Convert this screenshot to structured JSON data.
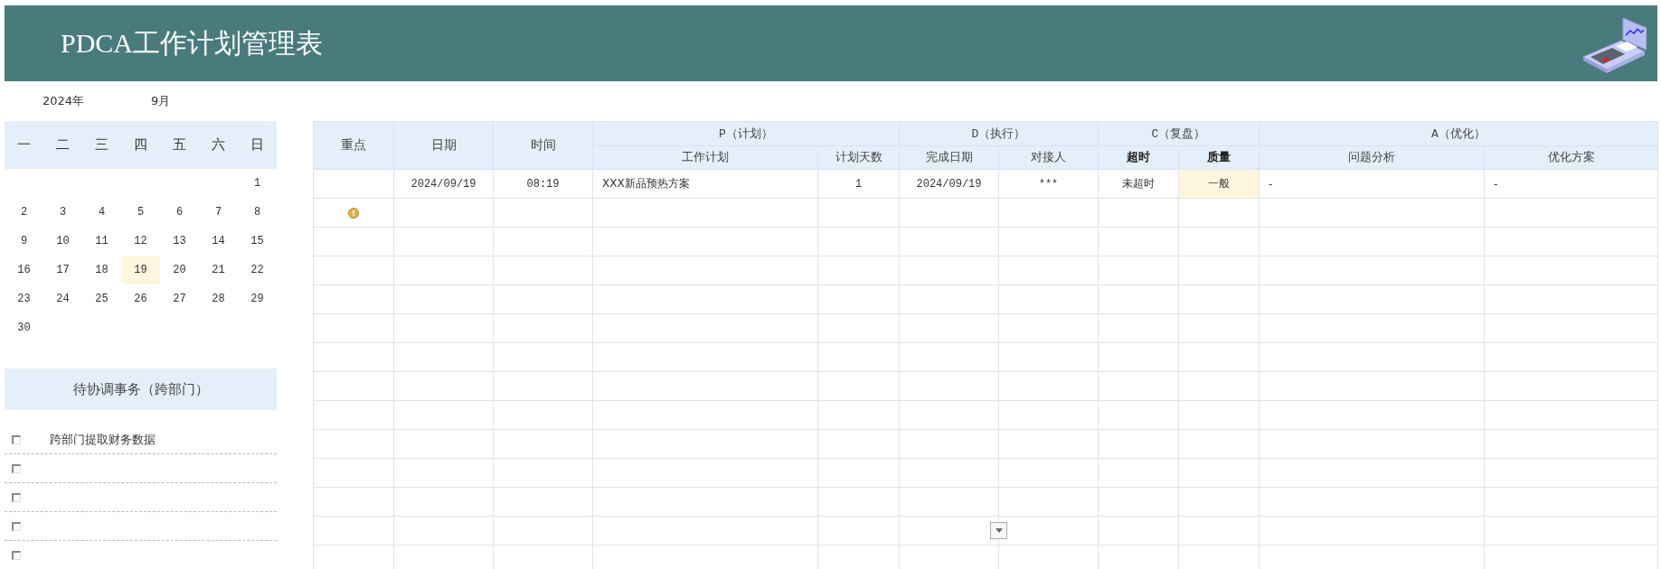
{
  "header": {
    "title": "PDCA工作计划管理表"
  },
  "calendar": {
    "year": "2024年",
    "month": "9月",
    "weekdays": [
      "一",
      "二",
      "三",
      "四",
      "五",
      "六",
      "日"
    ],
    "weeks": [
      [
        {
          "day": "1",
          "selected": false
        }
      ],
      [
        {
          "day": "2",
          "selected": false
        },
        {
          "day": "3",
          "selected": false
        },
        {
          "day": "4",
          "selected": false
        },
        {
          "day": "5",
          "selected": false
        },
        {
          "day": "6",
          "selected": false
        },
        {
          "day": "7",
          "selected": false
        },
        {
          "day": "8",
          "selected": false
        }
      ],
      [
        {
          "day": "9",
          "selected": false
        },
        {
          "day": "10",
          "selected": false
        },
        {
          "day": "11",
          "selected": false
        },
        {
          "day": "12",
          "selected": false
        },
        {
          "day": "13",
          "selected": false
        },
        {
          "day": "14",
          "selected": false
        },
        {
          "day": "15",
          "selected": false
        }
      ],
      [
        {
          "day": "16",
          "selected": false
        },
        {
          "day": "17",
          "selected": false
        },
        {
          "day": "18",
          "selected": false
        },
        {
          "day": "19",
          "selected": true
        },
        {
          "day": "20",
          "selected": false
        },
        {
          "day": "21",
          "selected": false
        },
        {
          "day": "22",
          "selected": false
        }
      ],
      [
        {
          "day": "23",
          "selected": false
        },
        {
          "day": "24",
          "selected": false
        },
        {
          "day": "25",
          "selected": false
        },
        {
          "day": "26",
          "selected": false
        },
        {
          "day": "27",
          "selected": false
        },
        {
          "day": "28",
          "selected": false
        },
        {
          "day": "29",
          "selected": false
        }
      ],
      [
        {
          "day": "30",
          "selected": false
        }
      ]
    ]
  },
  "todo": {
    "title": "待协调事务（跨部门）",
    "items": [
      {
        "text": "跨部门提取财务数据",
        "checked": false
      },
      {
        "checked": false
      },
      {
        "checked": false
      },
      {
        "checked": false
      },
      {
        "checked": false
      }
    ]
  },
  "table": {
    "columns": [
      {
        "label": "重点"
      },
      {
        "label": "日期"
      },
      {
        "label": "时间"
      },
      {
        "label": "P（计划）",
        "children": [
          {
            "label": "工作计划",
            "bold": false
          },
          {
            "label": "计划天数",
            "bold": false
          }
        ]
      },
      {
        "label": "D（执行）",
        "children": [
          {
            "label": "完成日期",
            "bold": false
          },
          {
            "label": "对接人",
            "bold": false
          }
        ]
      },
      {
        "label": "C（复盘）",
        "children": [
          {
            "label": "超时",
            "bold": true
          },
          {
            "label": "质量",
            "bold": true
          }
        ]
      },
      {
        "label": "A（优化）",
        "children": [
          {
            "label": "问题分析",
            "bold": false
          },
          {
            "label": "优化方案",
            "bold": false
          }
        ]
      }
    ],
    "rows": [
      {
        "important": false,
        "date": "2024/09/19",
        "time": "08:19",
        "plan": "XXX新品预热方案",
        "days": "1",
        "done_date": "2024/09/19",
        "contact": "***",
        "overtime": "未超时",
        "quality": "一般",
        "quality_highlighted": true,
        "analysis": "-",
        "optimization": "-"
      },
      {
        "important": true
      }
    ]
  }
}
